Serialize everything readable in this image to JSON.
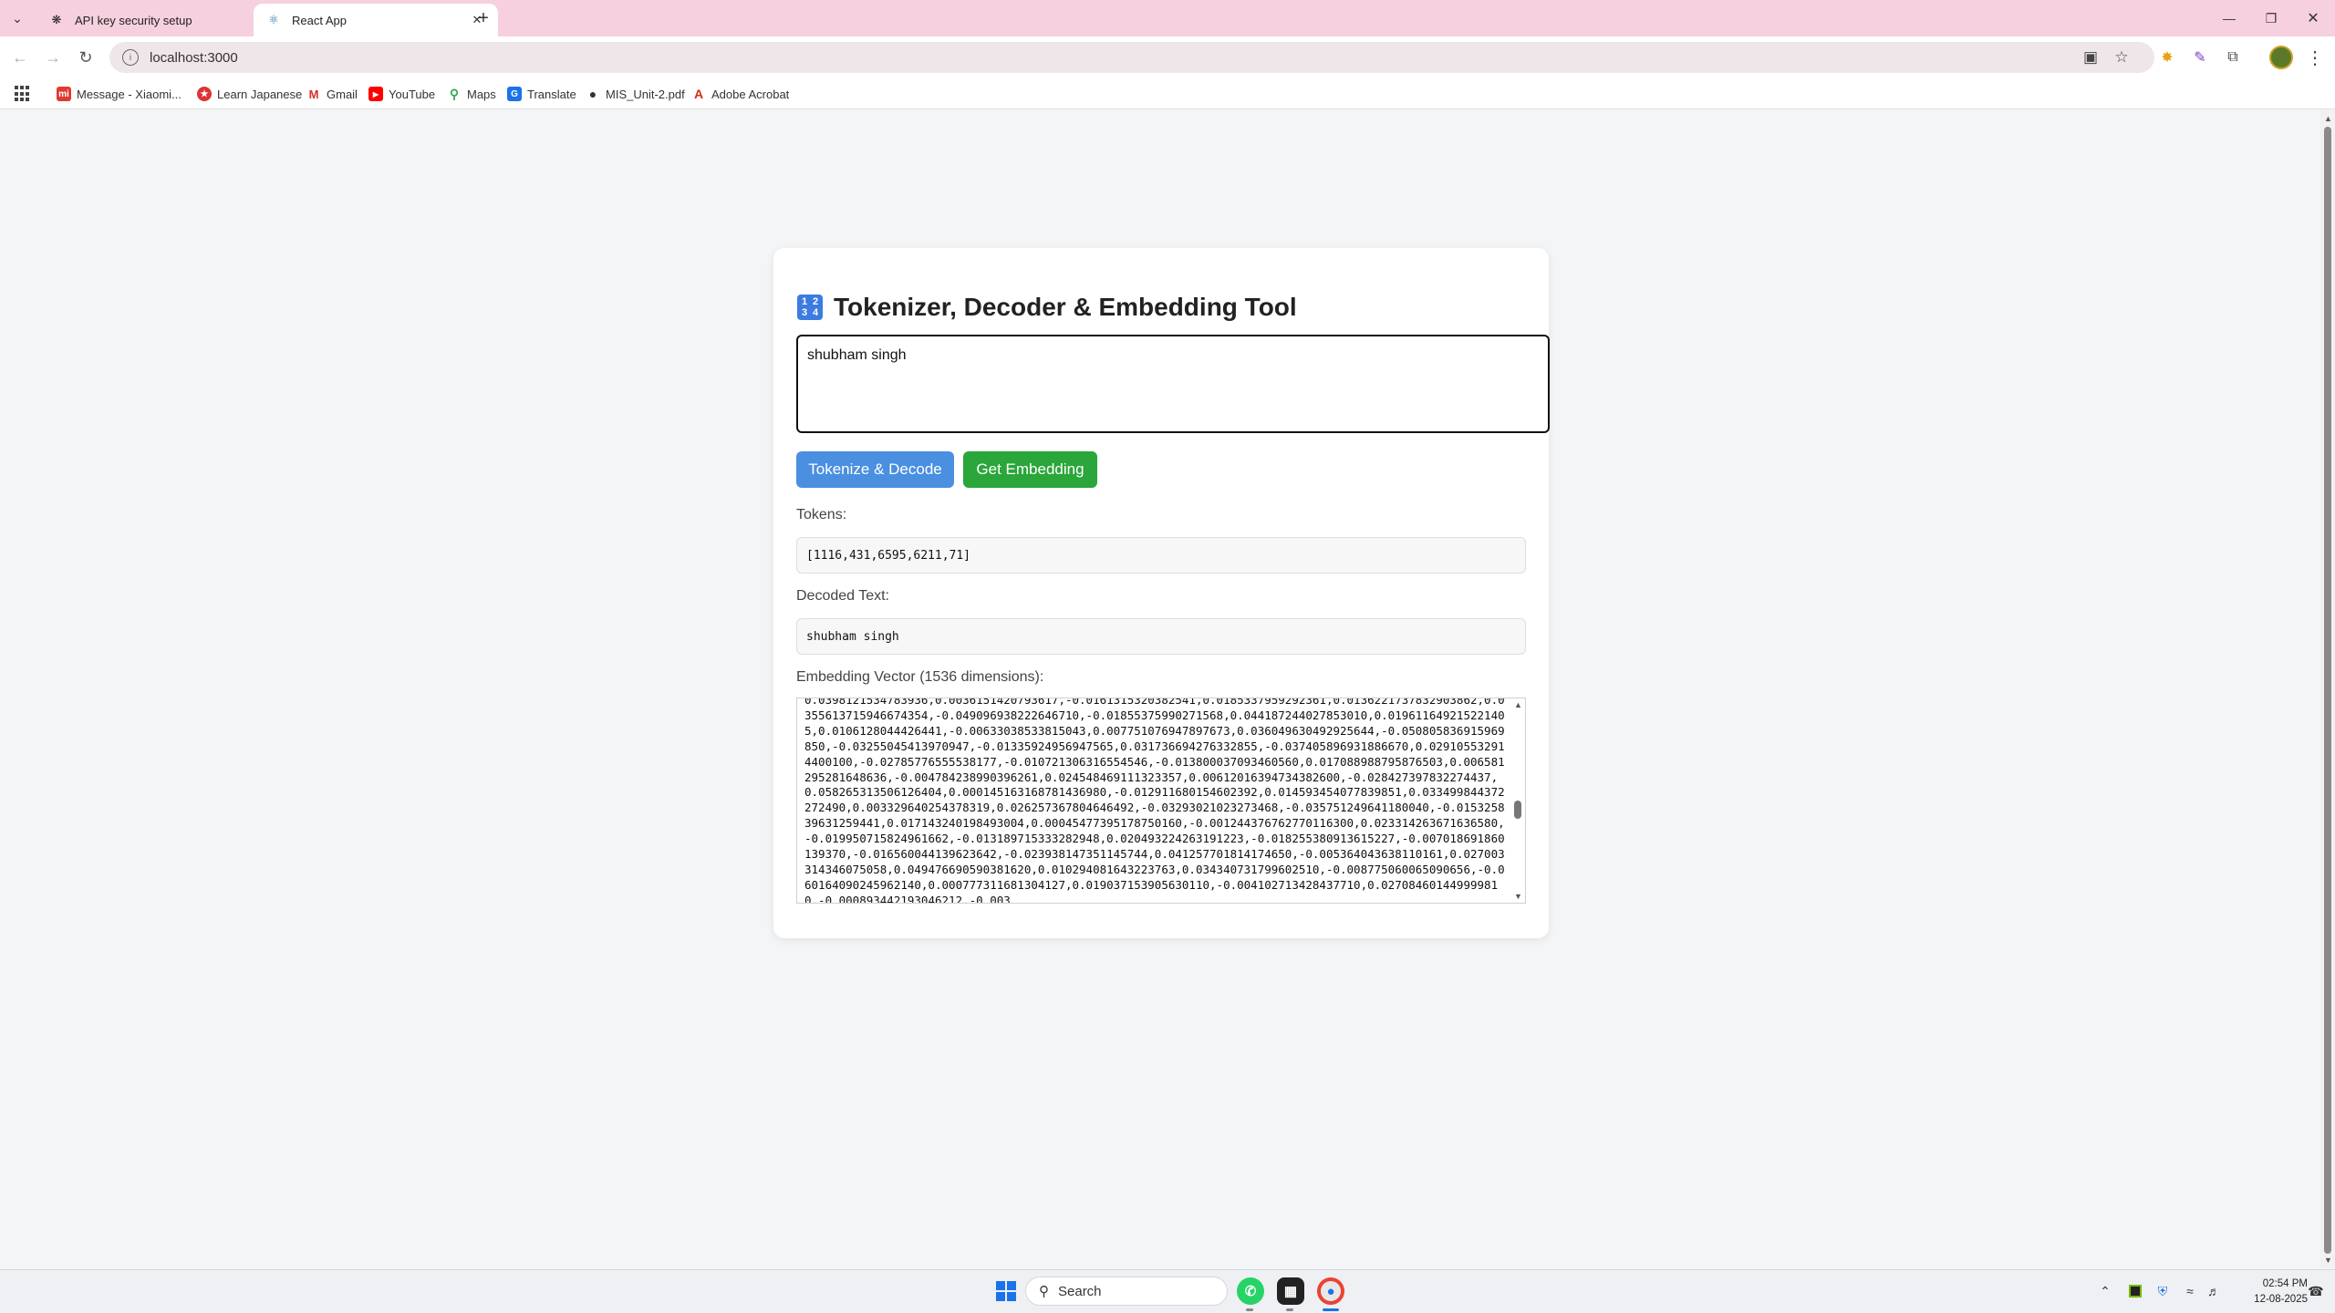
{
  "browser": {
    "tabs": [
      {
        "title": "API key security setup",
        "favicon": "chatgpt-icon",
        "active": false
      },
      {
        "title": "React App",
        "favicon": "react-icon",
        "active": true
      }
    ],
    "url": "localhost:3000",
    "bookmarks": [
      {
        "label": "Message - Xiaomi...",
        "icon": "xiaomi-icon",
        "color": "#e03a2f"
      },
      {
        "label": "Learn Japanese",
        "icon": "japanese-icon",
        "color": "#d33"
      },
      {
        "label": "Gmail",
        "icon": "gmail-icon",
        "color": "#d93025"
      },
      {
        "label": "YouTube",
        "icon": "youtube-icon",
        "color": "#ff0000"
      },
      {
        "label": "Maps",
        "icon": "maps-icon",
        "color": "#34a853"
      },
      {
        "label": "Translate",
        "icon": "translate-icon",
        "color": "#1a73e8"
      },
      {
        "label": "MIS_Unit-2.pdf",
        "icon": "globe-icon",
        "color": "#333333"
      },
      {
        "label": "Adobe Acrobat",
        "icon": "acrobat-icon",
        "color": "#d4291c"
      }
    ]
  },
  "app": {
    "title": "Tokenizer, Decoder & Embedding Tool",
    "title_icon_glyphs": [
      "1",
      "2",
      "3",
      "4"
    ],
    "input_text": "shubham singh",
    "tokenize_button": "Tokenize & Decode",
    "embedding_button": "Get Embedding",
    "tokens_label": "Tokens:",
    "tokens_value": "[1116,431,6595,6211,71]",
    "decoded_label": "Decoded Text:",
    "decoded_value": "shubham singh",
    "embedding_label": "Embedding Vector (1536 dimensions):",
    "embedding_text": "0.0398121534783936,0.0036151420793617,-0.0161315320382541,0.0185337959292361,0.0136221737832903862,0.0355613715946674354,-0.049096938222646710,-0.01855375990271568,0.044187244027853010,0.019611649215221405,0.0106128044426441,-0.00633038533815043,0.007751076947897673,0.036049630492925644,-0.050805836915969850,-0.03255045413970947,-0.01335924956947565,0.031736694276332855,-0.037405896931886670,0.029105532914400100,-0.02785776555538177,-0.010721306316554546,-0.013800037093460560,0.017088988795876503,0.006581295281648636,-0.004784238990396261,0.024548469111323357,0.00612016394734382600,-0.028427397832274437,0.058265313506126404,0.000145163168781436980,-0.012911680154602392,0.014593454077839851,0.033499844372272490,0.003329640254378319,0.026257367804646492,-0.03293021023273468,-0.035751249641180040,-0.015325839631259441,0.017143240198493004,0.00045477395178750160,-0.001244376762770116300,0.023314263671636580,-0.019950715824961662,-0.013189715333282948,0.020493224263191223,-0.018255380913615227,-0.007018691860139370,-0.016560044139623642,-0.023938147351145744,0.041257701814174650,-0.005364043638110161,0.027003314346075058,0.049476690590381620,0.010294081643223763,0.034340731799602510,-0.008775060065090656,-0.060164090245962140,0.000777311681304127,0.019037153905630110,-0.004102713428437710,0.027084601449999810,-0.000893442193046212,-0.003"
  },
  "taskbar": {
    "search_placeholder": "Search",
    "time": "02:54 PM",
    "date": "12-08-2025"
  }
}
